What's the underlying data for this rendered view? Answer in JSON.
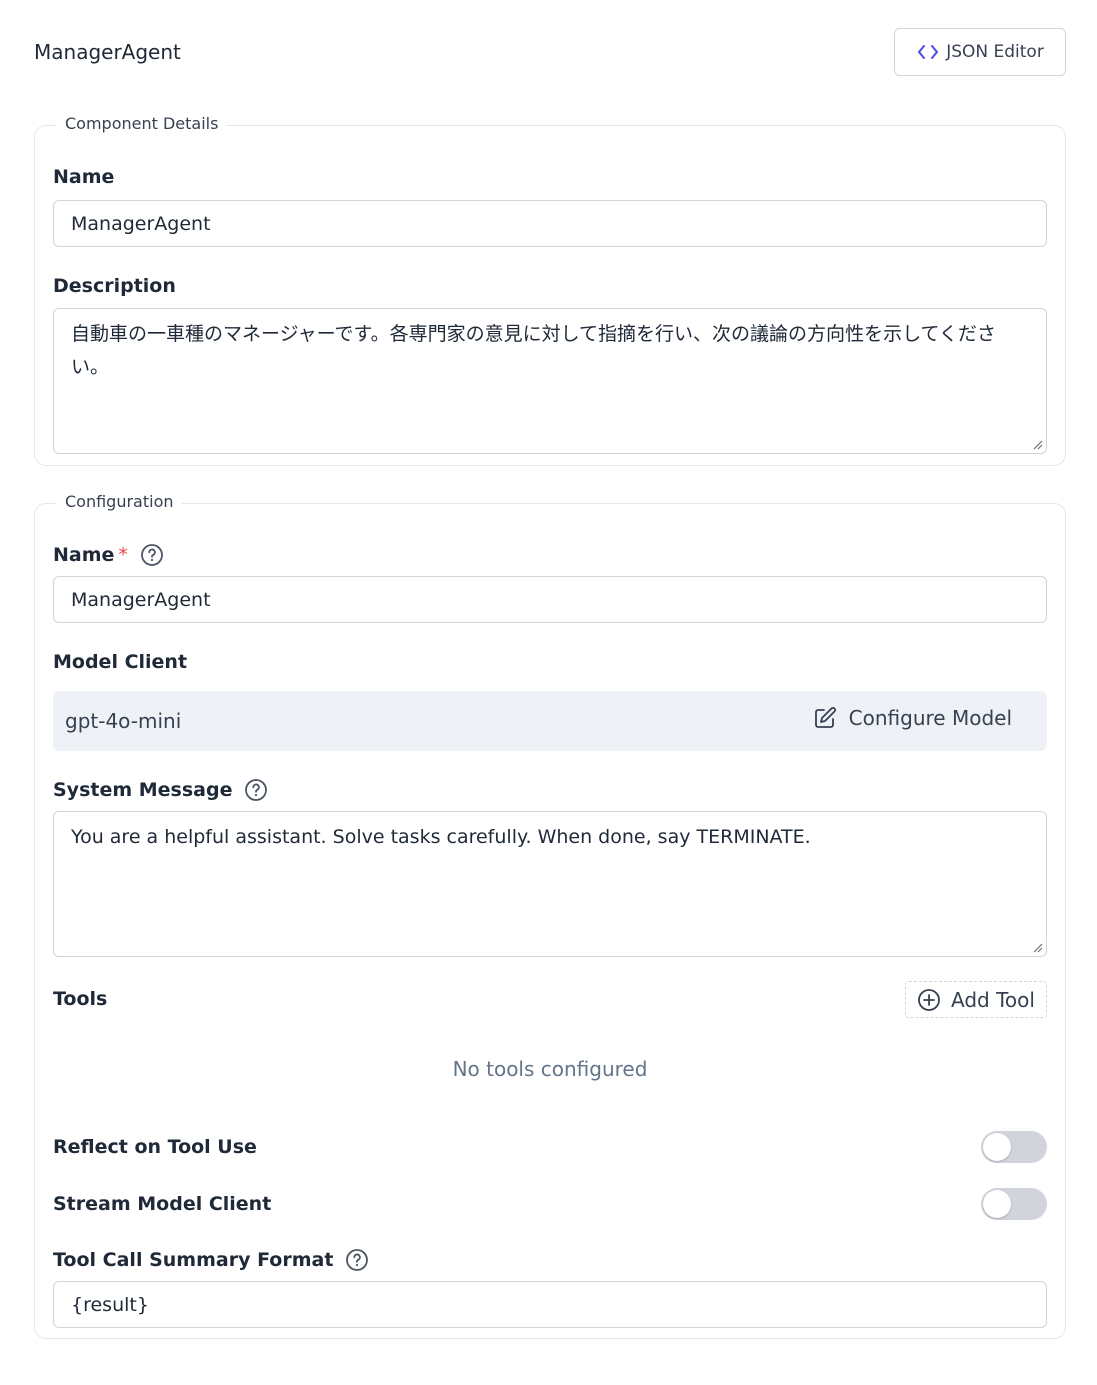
{
  "header": {
    "title": "ManagerAgent",
    "json_editor_label": "JSON Editor"
  },
  "component_details": {
    "legend": "Component Details",
    "name_label": "Name",
    "name_value": "ManagerAgent",
    "description_label": "Description",
    "description_value": "自動車の一車種のマネージャーです。各専門家の意見に対して指摘を行い、次の議論の方向性を示してください。"
  },
  "configuration": {
    "legend": "Configuration",
    "name_label": "Name",
    "required_mark": "*",
    "name_value": "ManagerAgent",
    "model_client_label": "Model Client",
    "model_client_value": "gpt-4o-mini",
    "configure_model_label": "Configure Model",
    "system_message_label": "System Message",
    "system_message_value": "You are a helpful assistant. Solve tasks carefully. When done, say TERMINATE.",
    "tools_label": "Tools",
    "add_tool_label": "Add Tool",
    "no_tools_text": "No tools configured",
    "reflect_label": "Reflect on Tool Use",
    "reflect_enabled": false,
    "stream_label": "Stream Model Client",
    "stream_enabled": false,
    "summary_format_label": "Tool Call Summary Format",
    "summary_format_value": "{result}"
  },
  "colors": {
    "accent": "#4f46e5",
    "required": "#ef4444",
    "toggle_off": "#d1d5db",
    "model_box_bg": "#eef2f6"
  },
  "icons": {
    "json_editor": "code-icon",
    "help": "help-circle-icon",
    "configure": "edit-icon",
    "add_tool": "plus-circle-icon"
  }
}
